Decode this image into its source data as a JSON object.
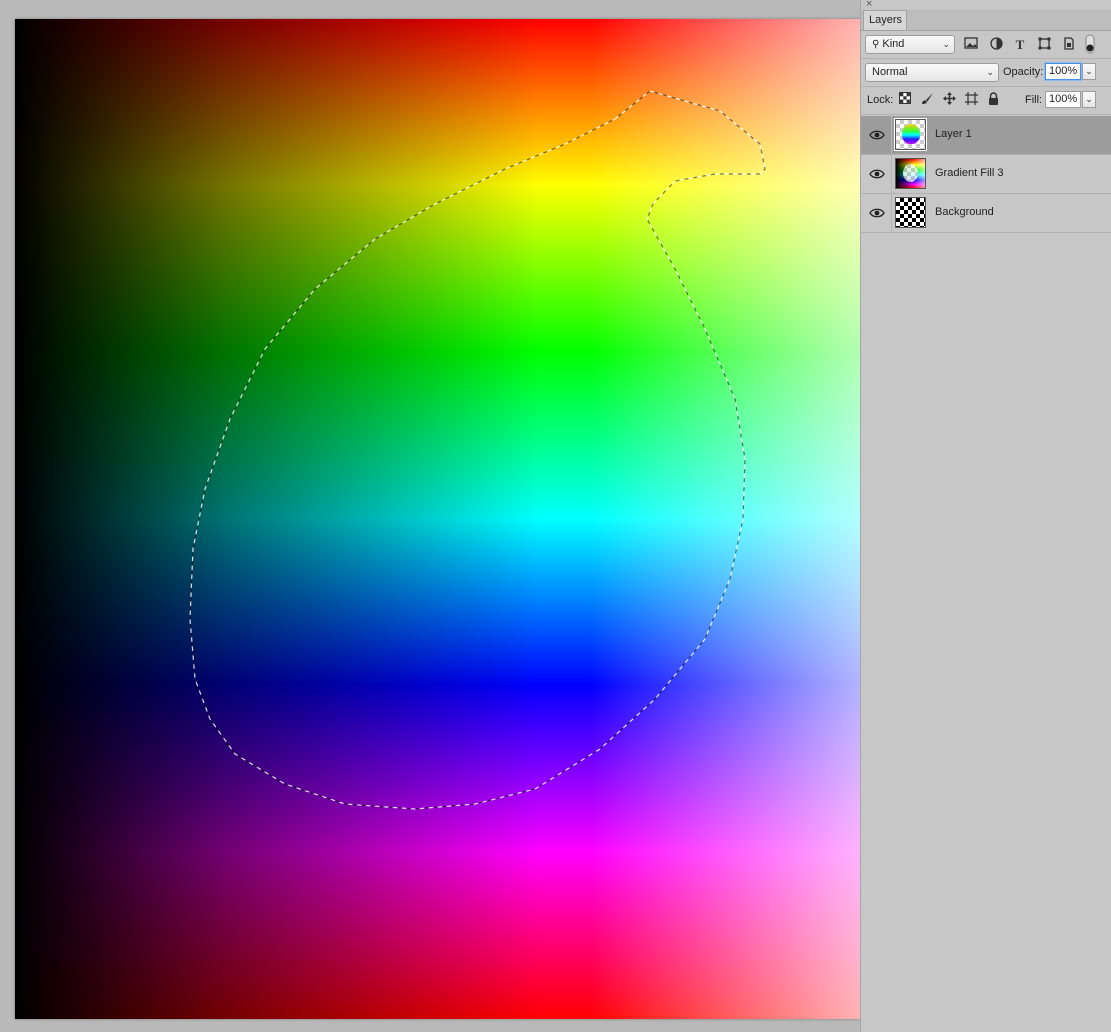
{
  "panel": {
    "close_glyph": "×",
    "tab_label": "Layers",
    "filter": {
      "label": "Kind",
      "icon": "search-icon"
    },
    "filter_icons": [
      "image-filter-icon",
      "adjustment-filter-icon",
      "type-filter-icon",
      "shape-filter-icon",
      "smart-object-filter-icon",
      "filter-toggle-icon"
    ],
    "blend_mode": "Normal",
    "opacity_label": "Opacity:",
    "opacity_value": "100%",
    "lock_label": "Lock:",
    "lock_icons": [
      "lock-transparent-pixels-icon",
      "lock-image-pixels-icon",
      "lock-position-icon",
      "lock-artboard-icon",
      "lock-all-icon"
    ],
    "fill_label": "Fill:",
    "fill_value": "100%"
  },
  "layers": [
    {
      "name": "Layer 1",
      "selected": true,
      "visible": true
    },
    {
      "name": "Gradient Fill 3",
      "selected": false,
      "visible": true
    },
    {
      "name": "Background",
      "selected": false,
      "visible": true
    }
  ],
  "colors": {
    "panel_bg": "#c7c7c7",
    "selected_row": "#9c9c9c",
    "focus_ring": "#4a8fe3",
    "canvas_bg": "#b9b9b9"
  }
}
